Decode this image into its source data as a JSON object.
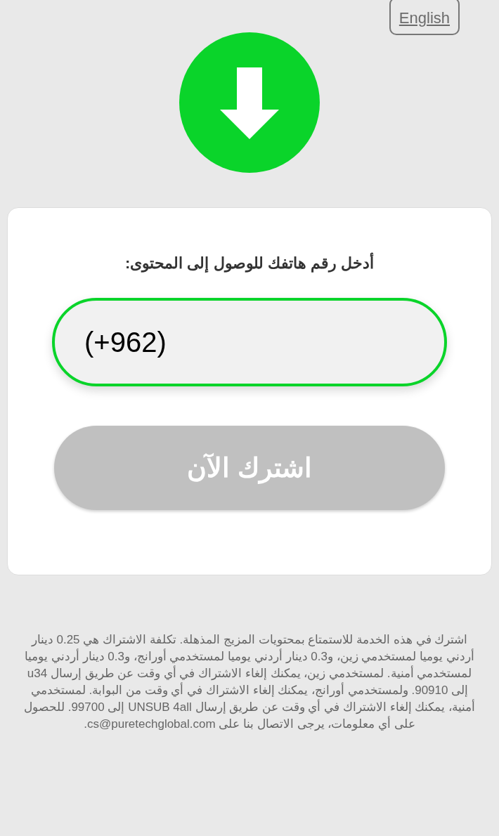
{
  "language_button": {
    "label": "English"
  },
  "form": {
    "title": "أدخل رقم هاتفك للوصول إلى المحتوى:",
    "phone_field": {
      "value": "(+962)"
    },
    "subscribe_button": {
      "label": "اشترك الآن",
      "disabled": true
    }
  },
  "footer": {
    "text": "اشترك في هذه الخدمة للاستمتاع بمحتويات المزيج المذهلة. تكلفة الاشتراك هي 0.25 دينار أردني يوميا لمستخدمي زين، و0.3 دينار أردني يوميا لمستخدمي أورانج، و0.3 دينار أردني يوميا لمستخدمي أمنية. لمستخدمي زين، يمكنك إلغاء الاشتراك في أي وقت عن طريق إرسال u34 إلى 90910. ولمستخدمي أورانج، يمكنك إلغاء الاشتراك في أي وقت من البوابة. لمستخدمي أمنية، يمكنك إلغاء الاشتراك في أي وقت عن طريق إرسال UNSUB 4all إلى 99700. للحصول على أي معلومات، يرجى الاتصال بنا على cs@puretechglobal.com."
  }
}
